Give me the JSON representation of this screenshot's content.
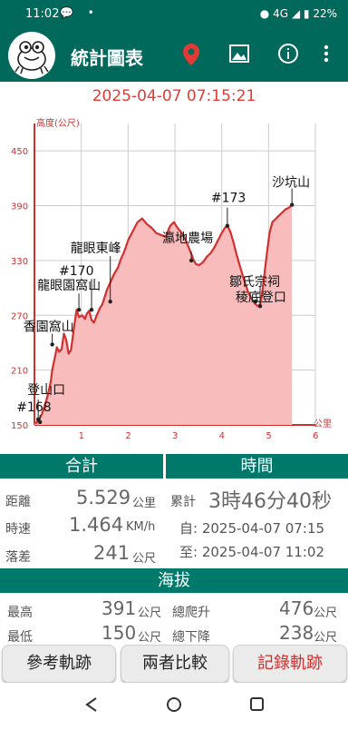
{
  "status_bar": {
    "time": "11:02",
    "network": "4G",
    "battery": "22%"
  },
  "app_bar": {
    "title": "統計圖表",
    "icons": [
      "map-pin-icon",
      "image-icon",
      "info-icon",
      "more-vert-icon"
    ]
  },
  "datetime": "2025-04-07 07:15:21",
  "chart_data": {
    "type": "area",
    "ylabel": "高度(公尺)",
    "xlabel": "公里",
    "xlim": [
      0,
      6
    ],
    "ylim": [
      150,
      480
    ],
    "yticks": [
      150,
      210,
      270,
      330,
      390,
      450
    ],
    "xticks": [
      1,
      2,
      3,
      4,
      5,
      6
    ],
    "colors": {
      "line": "#d32f2f",
      "fill": "#f8bcbc",
      "grid": "#cccccc"
    },
    "series": [
      {
        "x": [
          0,
          0.04,
          0.08,
          0.12,
          0.16,
          0.2,
          0.25,
          0.3,
          0.35,
          0.38,
          0.42,
          0.48,
          0.53,
          0.58,
          0.63,
          0.68,
          0.73,
          0.78,
          0.85,
          0.9,
          0.95,
          1.02,
          1.08,
          1.12,
          1.17,
          1.22,
          1.27,
          1.33,
          1.4,
          1.45,
          1.5,
          1.55,
          1.62,
          1.7,
          1.78,
          1.85,
          1.92,
          2.0,
          2.1,
          2.2,
          2.3,
          2.4,
          2.5,
          2.6,
          2.7,
          2.8,
          2.9,
          2.98,
          3.05,
          3.12,
          3.2,
          3.28,
          3.36,
          3.4,
          3.45,
          3.52,
          3.6,
          3.68,
          3.76,
          3.84,
          3.92,
          4.0,
          4.07,
          4.12,
          4.18,
          4.25,
          4.32,
          4.4,
          4.48,
          4.56,
          4.64,
          4.72,
          4.78,
          4.82,
          4.85,
          4.9,
          4.96,
          5.02,
          5.08,
          5.14,
          5.2,
          5.28,
          5.36,
          5.44,
          5.5
        ],
        "y": [
          153,
          152,
          155,
          158,
          162,
          168,
          176,
          186,
          198,
          210,
          220,
          235,
          230,
          233,
          250,
          243,
          228,
          232,
          258,
          276,
          268,
          270,
          266,
          272,
          275,
          265,
          262,
          270,
          278,
          282,
          290,
          298,
          306,
          315,
          322,
          332,
          340,
          352,
          362,
          372,
          376,
          370,
          366,
          360,
          358,
          356,
          368,
          372,
          366,
          362,
          356,
          346,
          336,
          330,
          326,
          325,
          328,
          334,
          338,
          344,
          352,
          360,
          366,
          368,
          362,
          350,
          336,
          322,
          308,
          296,
          288,
          282,
          280,
          282,
          290,
          310,
          336,
          360,
          372,
          375,
          378,
          382,
          386,
          388,
          391
        ]
      }
    ],
    "annotations": [
      {
        "label": "登山口",
        "x": 0.08,
        "y": 156
      },
      {
        "label": "#168",
        "x": 0.12,
        "y": 153
      },
      {
        "label": "香園窩山",
        "x": 0.38,
        "y": 238
      },
      {
        "label": "龍眼園窩山",
        "x": 0.95,
        "y": 276
      },
      {
        "label": "#170",
        "x": 1.22,
        "y": 276
      },
      {
        "label": "龍眼東峰",
        "x": 1.62,
        "y": 285
      },
      {
        "label": "瀛地農場",
        "x": 3.35,
        "y": 330
      },
      {
        "label": "#173",
        "x": 4.12,
        "y": 368
      },
      {
        "label": "稜底登口",
        "x": 4.72,
        "y": 285
      },
      {
        "label": "鄒氏宗祠",
        "x": 4.82,
        "y": 280
      },
      {
        "label": "沙坑山",
        "x": 5.5,
        "y": 391
      }
    ]
  },
  "stats": {
    "total_header": "合計",
    "time_header": "時間",
    "distance_label": "距離",
    "distance_value": "5.529",
    "distance_unit": "公里",
    "cumulative_label": "累計",
    "duration": "3時46分40秒",
    "speed_label": "時速",
    "speed_value": "1.464",
    "speed_unit": "KM/h",
    "start_time": "自: 2025-04-07 07:15",
    "drop_label": "落差",
    "drop_value": "241",
    "drop_unit": "公尺",
    "end_time": "至: 2025-04-07 11:02"
  },
  "altitude": {
    "header": "海拔",
    "max_label": "最高",
    "max_value": "391",
    "max_unit": "公尺",
    "climb_label": "總爬升",
    "climb_value": "476",
    "climb_unit": "公尺",
    "min_label": "最低",
    "min_value": "150",
    "min_unit": "公尺",
    "descent_label": "總下降",
    "descent_value": "238",
    "descent_unit": "公尺"
  },
  "buttons": {
    "reference": "參考軌跡",
    "compare": "兩者比較",
    "record": "記錄軌跡"
  }
}
